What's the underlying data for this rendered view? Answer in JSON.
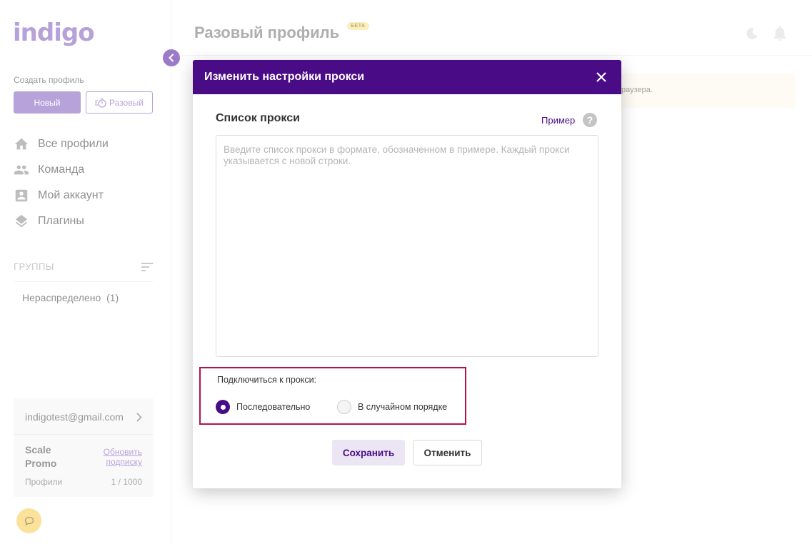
{
  "app": {
    "logo_text": "indigo",
    "accent_color": "#4a0b87",
    "brand_color": "#7c56ba"
  },
  "sidebar": {
    "create_label": "Создать профиль",
    "new_button": "Новый",
    "once_button": "Разовый",
    "nav": [
      {
        "label": "Все профили",
        "icon": "home-icon"
      },
      {
        "label": "Команда",
        "icon": "team-icon"
      },
      {
        "label": "Мой аккаунт",
        "icon": "account-icon"
      },
      {
        "label": "Плагины",
        "icon": "layers-icon"
      }
    ],
    "groups_title": "ГРУППЫ",
    "group_items": [
      {
        "label": "Нераспределено",
        "count": "(1)"
      }
    ],
    "account": {
      "email": "indigotest@gmail.com",
      "plan": "Scale Promo",
      "upgrade_link": "Обновить подписку",
      "profiles_label": "Профили",
      "profiles_value": "1 / 1000"
    }
  },
  "header": {
    "title": "Разовый профиль",
    "badge": "БЕТА"
  },
  "notice": {
    "text": "раузера."
  },
  "modal": {
    "title": "Изменить настройки прокси",
    "list_title": "Список прокси",
    "example_link": "Пример",
    "help_glyph": "?",
    "textarea_value": "",
    "textarea_placeholder": "Введите список прокси в формате, обозначенном в примере. Каждый прокси указывается с новой строки.",
    "connect_label": "Подключиться к прокси:",
    "options": [
      {
        "label": "Последовательно",
        "selected": true
      },
      {
        "label": "В случайном порядке",
        "selected": false
      }
    ],
    "save_button": "Сохранить",
    "cancel_button": "Отменить",
    "highlight_color": "#b3124b"
  }
}
